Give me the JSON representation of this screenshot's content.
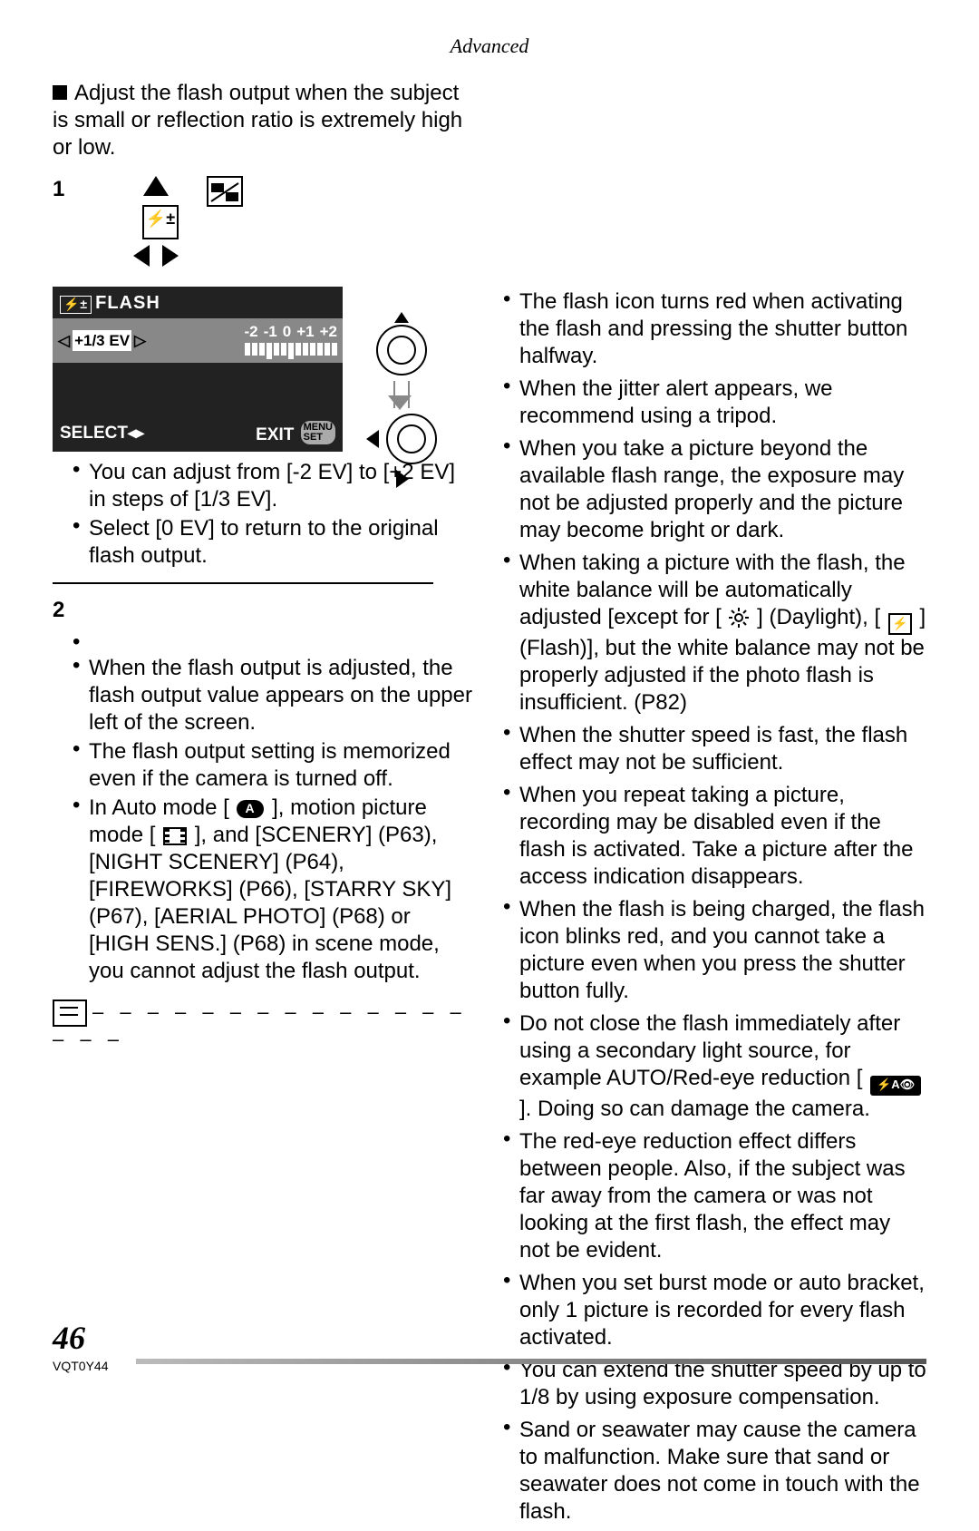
{
  "header": "Advanced",
  "left": {
    "intro": "Adjust the flash output when the subject is small or reflection ratio is extremely high or low.",
    "step1": {
      "num": "1",
      "bullets": [
        "You can adjust from [-2 EV] to [+2 EV] in steps of [1/3 EV].",
        "Select [0 EV] to return to the original flash output."
      ]
    },
    "lcd": {
      "title": "FLASH",
      "value": "+1/3 EV",
      "scale": [
        "-2",
        "-1",
        "0",
        "+1",
        "+2"
      ],
      "select": "SELECT",
      "exit": "EXIT",
      "menu": "MENU",
      "set": "SET"
    },
    "step2": {
      "num": "2",
      "bullets": [
        "When the flash output is adjusted, the flash output value appears on the upper left of the screen.",
        "The flash output setting is memorized even if the camera is turned off."
      ],
      "b3": {
        "a": "In Auto mode [",
        "b": "], motion picture mode [",
        "c": "], and [SCENERY] (P63), [NIGHT SCENERY] (P64), [FIREWORKS] (P66), [STARRY SKY] (P67), [AERIAL PHOTO] (P68) or [HIGH SENS.] (P68) in scene mode, you cannot adjust the flash output."
      }
    }
  },
  "right": {
    "0": "The flash icon turns red when activating the flash and pressing the shutter button halfway.",
    "1": "When the jitter alert appears, we recommend using a tripod.",
    "2": "When you take a picture beyond the available flash range, the exposure may not be adjusted properly and the picture may become bright or dark.",
    "3a": "When taking a picture with the flash, the white balance will be automatically adjusted [except for [",
    "3b": "] (Daylight), [",
    "3c": "] (Flash)], but the white balance may not be properly adjusted if the photo flash is insufficient. (P82)",
    "4": "When the shutter speed is fast, the flash effect may not be sufficient.",
    "5": "When you repeat taking a picture, recording may be disabled even if the flash is activated. Take a picture after the access indication disappears.",
    "6": "When the flash is being charged, the flash icon blinks red, and you cannot take a picture even when you press the shutter button fully.",
    "7a": "Do not close the flash immediately after using a secondary light source, for example AUTO/Red-eye reduction [",
    "7b": "]. Doing so can damage the camera.",
    "8": "The red-eye reduction effect differs between people. Also, if the subject was far away from the camera or was not looking at the first flash, the effect may not be evident.",
    "9": "When you set burst mode or auto bracket, only 1 picture is recorded for every flash activated.",
    "10": "You can extend the shutter speed by up to 1/8 by using exposure compensation.",
    "11": "Sand or seawater may cause the camera to malfunction. Make sure that sand or seawater does not come in touch with the flash."
  },
  "footer": {
    "page": "46",
    "docid": "VQT0Y44"
  }
}
